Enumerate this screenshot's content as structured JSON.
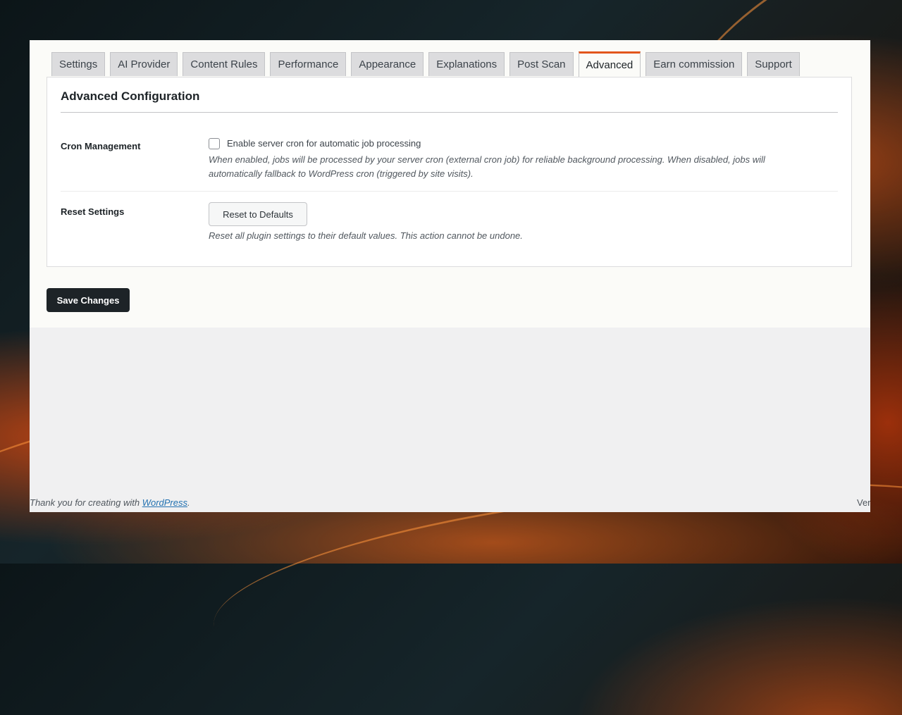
{
  "tabs": [
    {
      "label": "Settings"
    },
    {
      "label": "AI Provider"
    },
    {
      "label": "Content Rules"
    },
    {
      "label": "Performance"
    },
    {
      "label": "Appearance"
    },
    {
      "label": "Explanations"
    },
    {
      "label": "Post Scan"
    },
    {
      "label": "Advanced"
    },
    {
      "label": "Earn commission"
    },
    {
      "label": "Support"
    }
  ],
  "active_tab": "Advanced",
  "section": {
    "title": "Advanced Configuration",
    "cron": {
      "label": "Cron Management",
      "checkbox_label": "Enable server cron for automatic job processing",
      "checked": false,
      "description_line1": "When enabled, jobs will be processed by your server cron (external cron job) for reliable background processing. When disabled, jobs will",
      "description_line2": "automatically fallback to WordPress cron (triggered by site visits)."
    },
    "reset": {
      "label": "Reset Settings",
      "button_label": "Reset to Defaults",
      "description": "Reset all plugin settings to their default values. This action cannot be undone."
    }
  },
  "save_button_label": "Save Changes",
  "footer": {
    "prefix": "Thank you for creating with ",
    "link_text": "WordPress",
    "suffix": ".",
    "version": "Ver"
  },
  "colors": {
    "active_tab_accent": "#e2561c",
    "primary_button": "#1d2327",
    "link": "#2271b1"
  }
}
